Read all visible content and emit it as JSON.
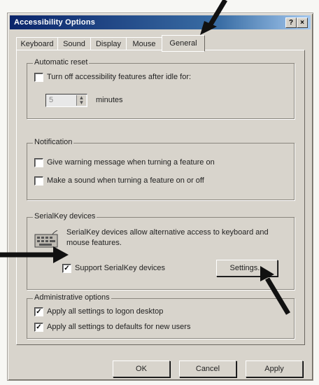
{
  "window": {
    "title": "Accessibility Options",
    "help_label": "?",
    "close_label": "×"
  },
  "tabs": [
    {
      "label": "Keyboard",
      "active": false
    },
    {
      "label": "Sound",
      "active": false
    },
    {
      "label": "Display",
      "active": false
    },
    {
      "label": "Mouse",
      "active": false
    },
    {
      "label": "General",
      "active": true
    }
  ],
  "automatic_reset": {
    "title": "Automatic reset",
    "turn_off_label": "Turn off accessibility features after idle for:",
    "turn_off_checked": false,
    "minutes_value": "5",
    "minutes_label": "minutes"
  },
  "notification": {
    "title": "Notification",
    "warning_label": "Give warning message when turning a feature on",
    "warning_checked": false,
    "sound_label": "Make a sound when turning a feature on or off",
    "sound_checked": false
  },
  "serialkey": {
    "title": "SerialKey devices",
    "description": "SerialKey devices allow alternative access to keyboard and mouse features.",
    "support_label": "Support SerialKey devices",
    "support_checked": true,
    "settings_label": "Settings..."
  },
  "admin": {
    "title": "Administrative options",
    "logon_label": "Apply all settings to logon desktop",
    "logon_checked": true,
    "defaults_label": "Apply all settings to defaults for new users",
    "defaults_checked": true
  },
  "buttons": {
    "ok": "OK",
    "cancel": "Cancel",
    "apply": "Apply"
  },
  "check_glyph": "✓"
}
